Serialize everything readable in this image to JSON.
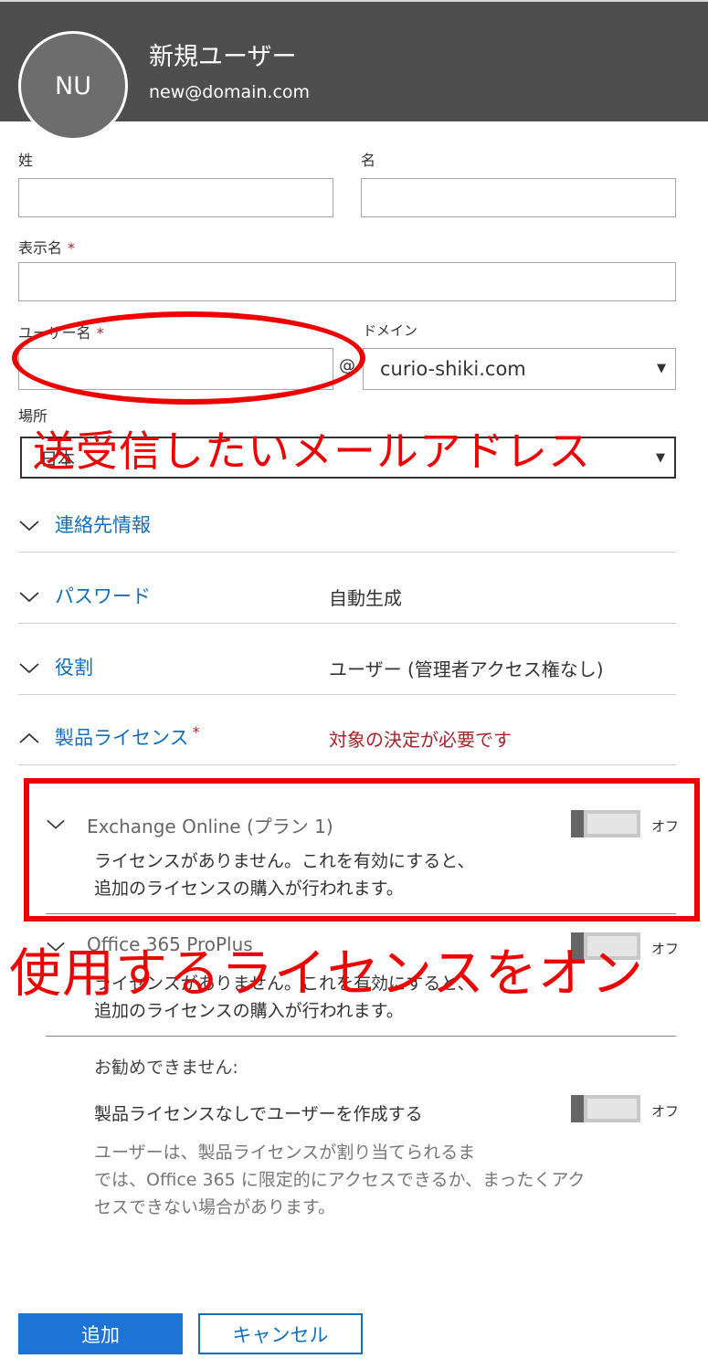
{
  "header": {
    "avatar_initials": "NU",
    "title": "新規ユーザー",
    "email": "new@domain.com"
  },
  "form": {
    "last_name_label": "姓",
    "first_name_label": "名",
    "last_name_value": "",
    "first_name_value": "",
    "display_name_label": "表示名",
    "display_name_value": "",
    "required_mark": "*",
    "username_label": "ユーザー名",
    "username_value": "",
    "at_sign": "@",
    "domain_label": "ドメイン",
    "domain_value": "curio-shiki.com",
    "location_label": "場所",
    "location_value": "日本"
  },
  "sections": {
    "contact": {
      "title": "連絡先情報"
    },
    "password": {
      "title": "パスワード",
      "value": "自動生成"
    },
    "role": {
      "title": "役割",
      "value": "ユーザー (管理者アクセス権なし)"
    },
    "license": {
      "title": "製品ライセンス",
      "warning": "対象の決定が必要です"
    }
  },
  "licenses": [
    {
      "name": "Exchange Online (プラン 1)",
      "desc_line1": "ライセンスがありません。これを有効にすると、",
      "desc_line2": "追加のライセンスの購入が行われます。",
      "toggle_label": "オフ",
      "on": false
    },
    {
      "name": "Office 365 ProPlus",
      "desc_line1": "ライセンスがありません。これを有効にすると、",
      "desc_line2": "追加のライセンスの購入が行われます。",
      "toggle_label": "オフ",
      "on": false
    }
  ],
  "not_recommended": {
    "heading": "お勧めできません:",
    "option_label": "製品ライセンスなしでユーザーを作成する",
    "toggle_label": "オフ",
    "note_line1": "ユーザーは、製品ライセンスが割り当てられるま",
    "note_line2": "では、Office 365 に限定的にアクセスできるか、まったくアク",
    "note_line3": "セスできない場合があります。"
  },
  "buttons": {
    "add": "追加",
    "cancel": "キャンセル"
  },
  "annotations": {
    "username_note": "送受信したいメールアドレス",
    "license_note": "使用するライセンスをオン",
    "color": "#ee0000"
  },
  "colors": {
    "header_bg": "#4e4e4e",
    "link_blue": "#106ebe",
    "primary_button": "#1e74d6",
    "required_red": "#a4262c"
  }
}
